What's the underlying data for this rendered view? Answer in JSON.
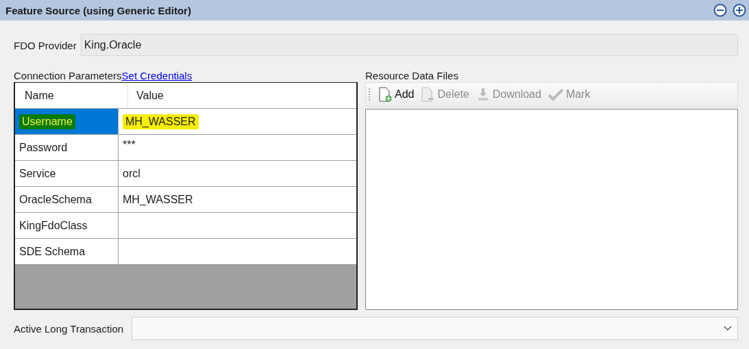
{
  "header": {
    "title": "Feature Source (using Generic Editor)"
  },
  "provider": {
    "label": "FDO Provider",
    "value": "King.Oracle"
  },
  "connection": {
    "label": "Connection Parameters",
    "link": "Set Credentials",
    "columns": [
      "Name",
      "Value"
    ],
    "rows": [
      {
        "name": "Username",
        "value": "MH_WASSER",
        "selected": true,
        "highlighted": true
      },
      {
        "name": "Password",
        "value": "***",
        "selected": false,
        "highlighted": false
      },
      {
        "name": "Service",
        "value": "orcl",
        "selected": false,
        "highlighted": false
      },
      {
        "name": "OracleSchema",
        "value": "MH_WASSER",
        "selected": false,
        "highlighted": false
      },
      {
        "name": "KingFdoClass",
        "selected": false,
        "highlighted": false
      },
      {
        "name": "SDE Schema",
        "selected": false,
        "highlighted": false
      }
    ]
  },
  "resources": {
    "label": "Resource Data Files",
    "toolbar": [
      {
        "kind": "add",
        "label": "Add",
        "disabled": false
      },
      {
        "kind": "delete",
        "label": "Delete",
        "disabled": true
      },
      {
        "kind": "download",
        "label": "Download",
        "disabled": true
      },
      {
        "kind": "mark",
        "label": "Mark",
        "disabled": true
      }
    ]
  },
  "transaction": {
    "label": "Active Long Transaction"
  }
}
